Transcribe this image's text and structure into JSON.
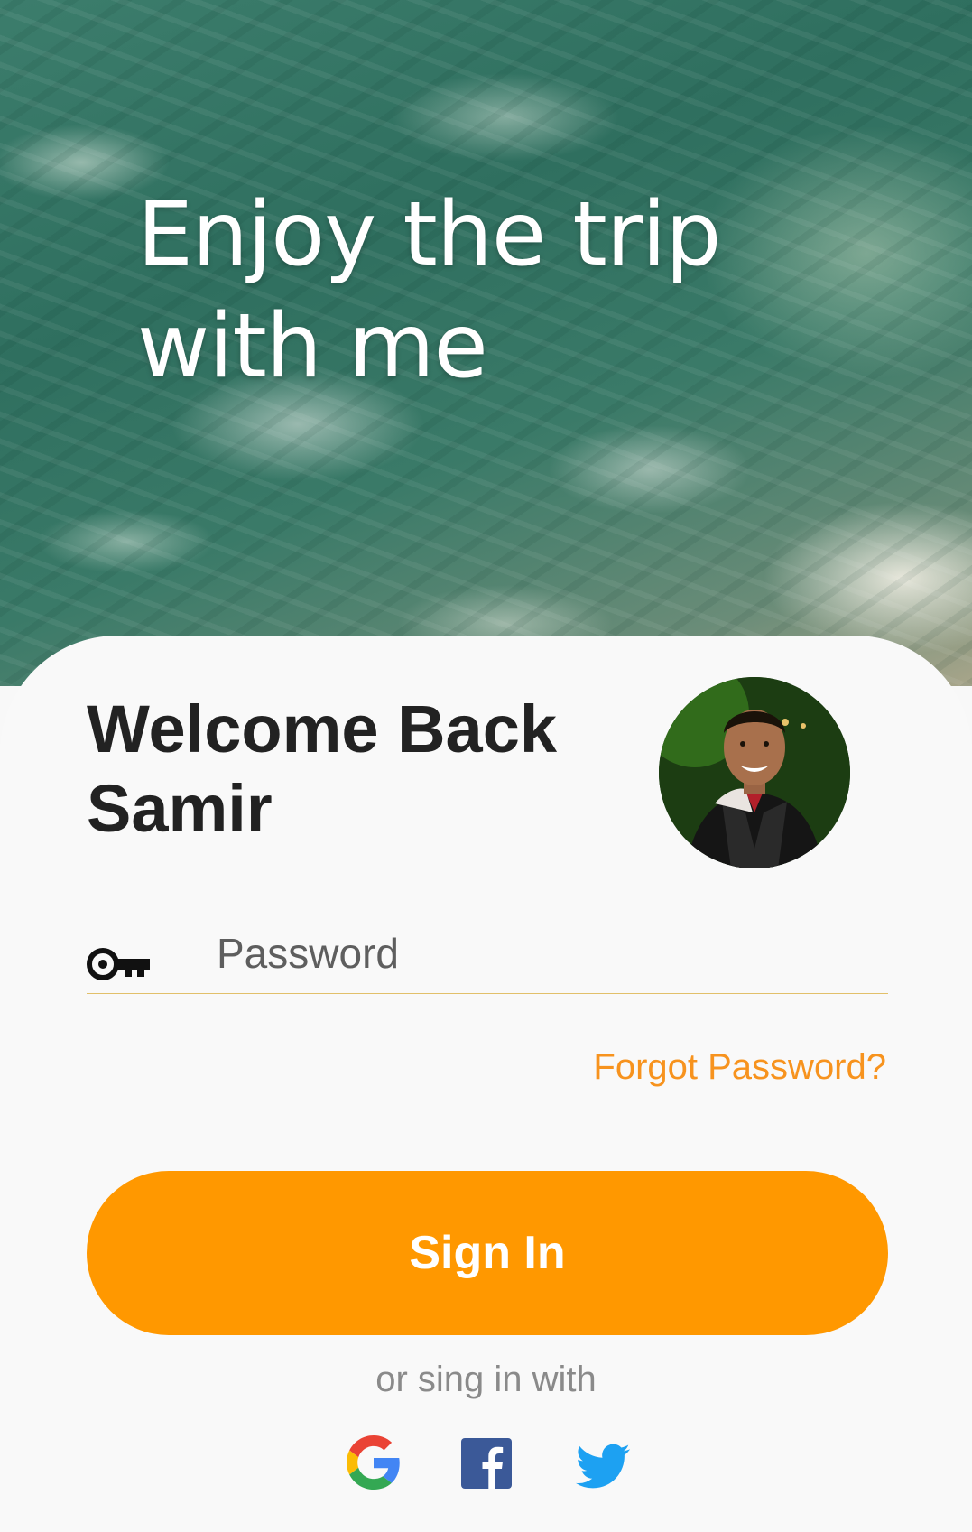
{
  "hero": {
    "title_line1": "Enjoy the trip",
    "title_line2": "with me"
  },
  "welcome": {
    "line1": "Welcome Back",
    "line2": "Samir"
  },
  "avatar": {
    "alt": "Samir profile photo"
  },
  "password": {
    "icon": "key-icon",
    "placeholder": "Password",
    "value": ""
  },
  "forgot_label": "Forgot Password?",
  "signin_label": "Sign In",
  "alt_signin_text": "or sing in with",
  "social": [
    {
      "name": "google",
      "icon": "google-icon"
    },
    {
      "name": "facebook",
      "icon": "facebook-icon"
    },
    {
      "name": "twitter",
      "icon": "twitter-icon"
    }
  ],
  "colors": {
    "accent": "#ff9800",
    "link": "#f7931e",
    "card_bg": "#f9f9f9",
    "underline": "#e2c06a",
    "facebook": "#3b5998",
    "twitter": "#1da1f2"
  }
}
